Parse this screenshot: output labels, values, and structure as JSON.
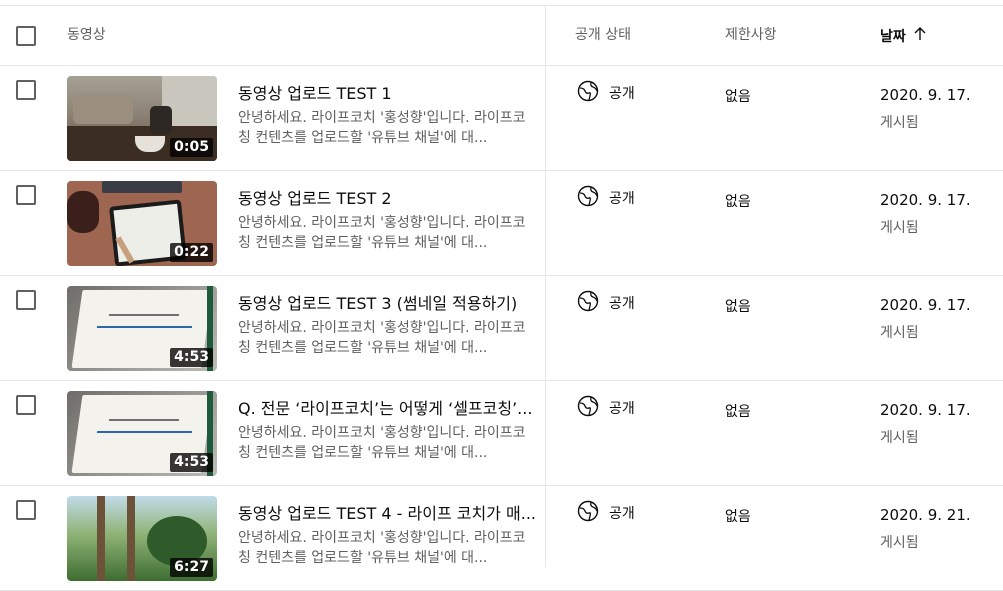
{
  "header": {
    "video_label": "동영상",
    "visibility_label": "공개 상태",
    "restriction_label": "제한사항",
    "date_label": "날짜"
  },
  "rows": [
    {
      "title": "동영상 업로드 TEST 1",
      "desc": "안녕하세요. 라이프코치 '홍성향'입니다. 라이프코칭 컨텐츠를 업로드할 '유튜브 채널'에 대...",
      "duration": "0:05",
      "visibility": "공개",
      "restriction": "없음",
      "date": "2020. 9. 17.",
      "status": "게시됨"
    },
    {
      "title": "동영상 업로드 TEST 2",
      "desc": "안녕하세요. 라이프코치 '홍성향'입니다. 라이프코칭 컨텐츠를 업로드할 '유튜브 채널'에 대...",
      "duration": "0:22",
      "visibility": "공개",
      "restriction": "없음",
      "date": "2020. 9. 17.",
      "status": "게시됨"
    },
    {
      "title": "동영상 업로드 TEST 3 (썸네일 적용하기)",
      "desc": "안녕하세요. 라이프코치 '홍성향'입니다. 라이프코칭 컨텐츠를 업로드할 '유튜브 채널'에 대...",
      "duration": "4:53",
      "visibility": "공개",
      "restriction": "없음",
      "date": "2020. 9. 17.",
      "status": "게시됨"
    },
    {
      "title": "Q. 전문 ‘라이프코치’는 어떻게 ‘셀프코칭’...",
      "desc": "안녕하세요. 라이프코치 '홍성향'입니다. 라이프코칭 컨텐츠를 업로드할 '유튜브 채널'에 대...",
      "duration": "4:53",
      "visibility": "공개",
      "restriction": "없음",
      "date": "2020. 9. 17.",
      "status": "게시됨"
    },
    {
      "title": "동영상 업로드 TEST 4 - 라이프 코치가 매...",
      "desc": "안녕하세요. 라이프코치 '홍성향'입니다. 라이프코칭 컨텐츠를 업로드할 '유튜브 채널'에 대...",
      "duration": "6:27",
      "visibility": "공개",
      "restriction": "없음",
      "date": "2020. 9. 21.",
      "status": "게시됨"
    }
  ],
  "icons": {
    "visibility": "globe-icon",
    "sort": "arrow-up-icon"
  },
  "colors": {
    "secondary_text": "#606060",
    "divider": "#e5e5e5"
  }
}
